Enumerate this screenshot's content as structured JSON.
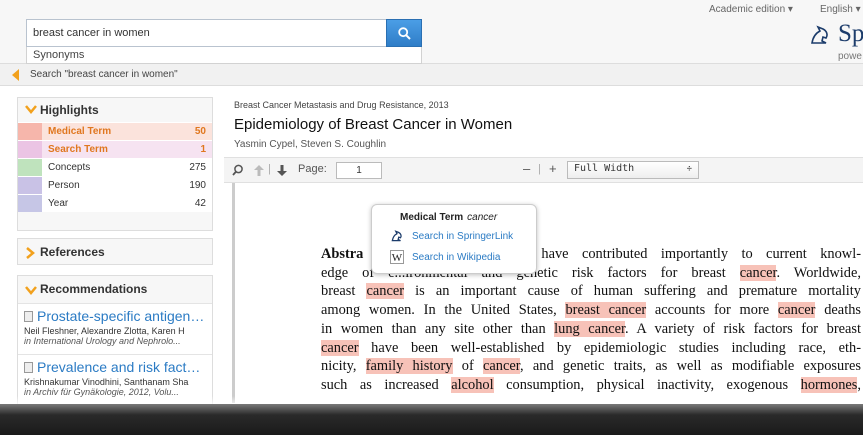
{
  "header": {
    "search_value": "breast cancer in women",
    "synonyms_label": "Synonyms",
    "edition": "Academic edition ▾",
    "language": "English ▾",
    "logo_text": "Sp",
    "powered_text": "powe"
  },
  "breadcrumb": {
    "text": "Search \"breast cancer in women\""
  },
  "highlights": {
    "title": "Highlights",
    "items": [
      {
        "label": "Medical Term",
        "count": "50",
        "color": "#f6b6ab"
      },
      {
        "label": "Search Term",
        "count": "1",
        "color": "#ebc4e4"
      },
      {
        "label": "Concepts",
        "count": "275",
        "color": "#bfe3bd"
      },
      {
        "label": "Person",
        "count": "190",
        "color": "#c9c2e6"
      },
      {
        "label": "Year",
        "count": "42",
        "color": "#c6c6e6"
      }
    ]
  },
  "references": {
    "title": "References"
  },
  "recommendations": {
    "title": "Recommendations",
    "items": [
      {
        "title": "Prostate-specific antigen t...",
        "authors": "Neil Fleshner, Alexandre Zlotta, Karen H",
        "journal": "in International Urology and Nephrolo..."
      },
      {
        "title": "Prevalence and risk factor...",
        "authors": "Krishnakumar Vinodhini, Santhanam Sha",
        "journal": "in Archiv für Gynäkologie, 2012, Volu..."
      }
    ]
  },
  "document": {
    "series": "Breast Cancer Metastasis and Drug Resistance, 2013",
    "title": "Epidemiology of Breast Cancer in Women",
    "authors": "Yasmin Cypel,   Steven S. Coughlin"
  },
  "toolbar": {
    "page_label": "Page:",
    "page_value": "1",
    "minus": "–",
    "separator": "|",
    "plus": "+",
    "zoom_value": "Full Width",
    "zoom_caret": "÷"
  },
  "popup": {
    "title_label": "Medical Term",
    "term": "cancer",
    "link_springer": "Search in SpringerLink",
    "link_wikipedia": "Search in Wikipedia"
  },
  "text": {
    "l1a": "Abstra",
    "l1b": "have contributed importantly to current knowl-",
    "l2a": "edge of e...ironmental and genetic risk factors for breast ",
    "l2h1": "cancer",
    "l2b": ". Worldwide,",
    "l3a": "breast ",
    "l3h1": "cancer",
    "l3b": " is an important cause of human suffering and premature mortality",
    "l4a": "among women. In the United States, ",
    "l4h1": "breast cancer",
    "l4b": " accounts for more ",
    "l4h2": "cancer",
    "l4c": " deaths",
    "l5a": "in women than any site other than ",
    "l5h1": "lung cancer",
    "l5b": ". A variety of risk factors for breast",
    "l6h1": "cancer",
    "l6a": " have been well-established by epidemiologic studies including race, eth-",
    "l7a": "nicity, ",
    "l7h1": "family history",
    "l7b": " of ",
    "l7h2": "cancer",
    "l7c": ", and genetic traits, as well as modifiable exposures",
    "l8a": "such as increased ",
    "l8h1": "alcohol",
    "l8b": " consumption, physical inactivity, exogenous ",
    "l8h2": "hormones",
    "l8c": ","
  }
}
